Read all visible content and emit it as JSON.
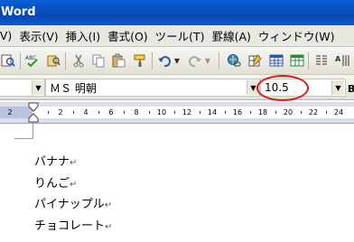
{
  "window": {
    "title": "Word"
  },
  "menu": [
    "(V)",
    "表示(V)",
    "挿入(I)",
    "書式(O)",
    "ツール(T)",
    "罫線(A)",
    "ウィンドウ(W)"
  ],
  "formatting": {
    "font_name": "ＭＳ 明朝",
    "font_size": "10.5"
  },
  "ruler": {
    "numbers": [
      "2",
      "2",
      "4",
      "6",
      "8",
      "10",
      "12",
      "14",
      "16",
      "18",
      "20",
      "22",
      "24"
    ]
  },
  "document": {
    "lines": [
      "バナナ",
      "りんご",
      "パイナップル",
      "チョコレート"
    ],
    "paragraph_mark": "↵"
  },
  "colors": {
    "titlebar": "#0a55cc",
    "annotation": "#e01818"
  },
  "toolbar_icons": [
    "print-preview-icon",
    "spelling-icon",
    "research-icon",
    "cut-icon",
    "copy-icon",
    "paste-icon",
    "format-painter-icon",
    "undo-icon",
    "redo-icon",
    "hyperlink-icon",
    "tables-borders-icon",
    "insert-table-icon",
    "insert-excel-icon",
    "columns-icon",
    "drawing-icon"
  ]
}
